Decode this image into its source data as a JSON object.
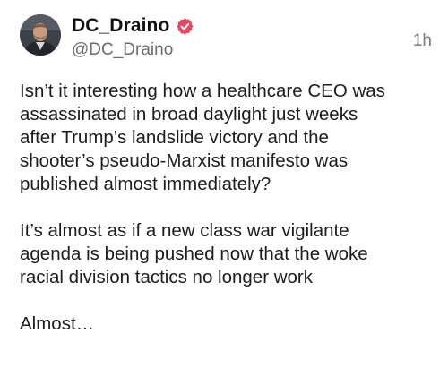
{
  "post": {
    "author": {
      "display_name": "DC_Draino",
      "handle": "@DC_Draino",
      "verified": true,
      "avatar_icon": "profile-photo"
    },
    "timestamp": "1h",
    "paragraphs": [
      "Isn’t it interesting how a healthcare CEO was\nassassinated in broad daylight just weeks\nafter Trump’s landslide victory and the\nshooter’s pseudo-Marxist manifesto was\npublished almost immediately?",
      "It’s almost as if a new class war vigilante\nagenda is being pushed now that the woke\nracial division tactics no longer work",
      "Almost…"
    ]
  },
  "colors": {
    "verified_badge": "#e8465f",
    "handle_text": "#6d6d6d",
    "body_text": "#1c1c1c"
  }
}
